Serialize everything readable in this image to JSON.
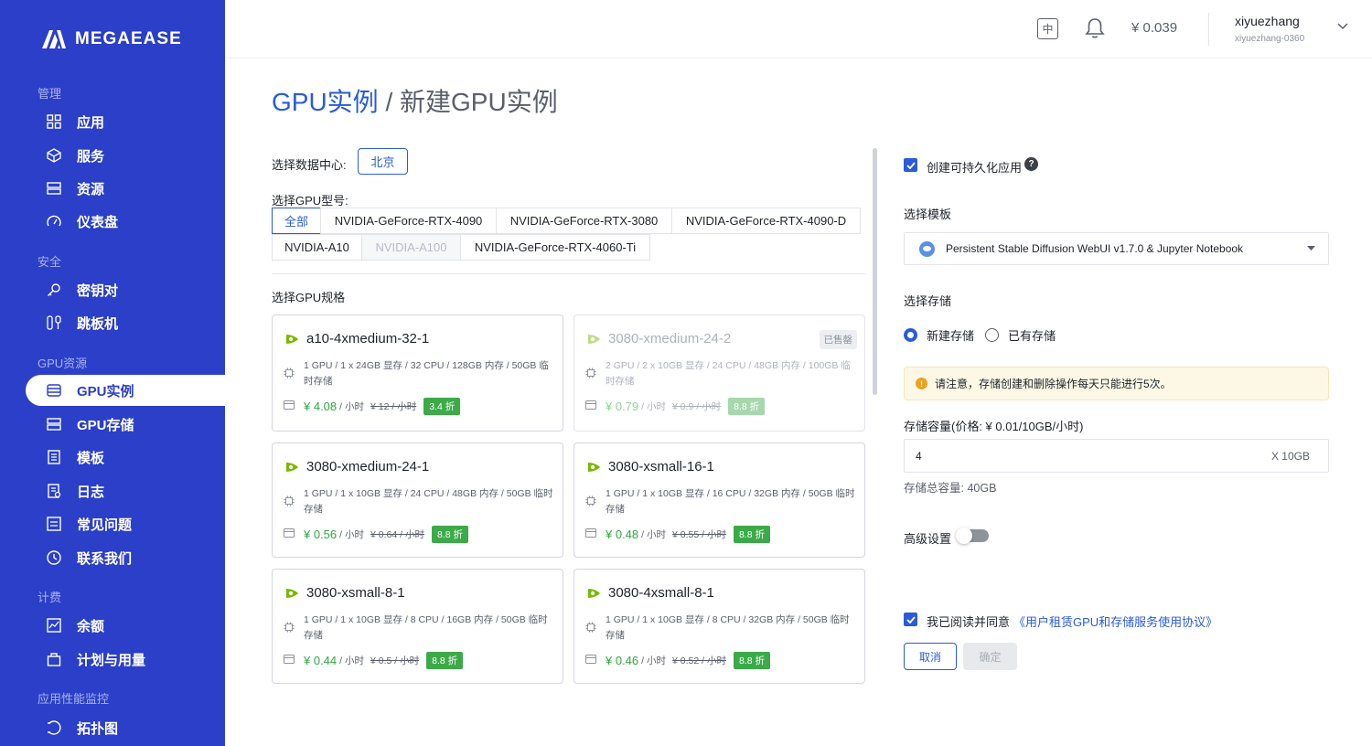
{
  "brand": {
    "name": "MEGAEASE"
  },
  "sidebar": {
    "sections": [
      {
        "title": "管理",
        "items": [
          {
            "label": "应用",
            "icon": "grid-icon"
          },
          {
            "label": "服务",
            "icon": "cube-icon"
          },
          {
            "label": "资源",
            "icon": "server-icon"
          },
          {
            "label": "仪表盘",
            "icon": "gauge-icon"
          }
        ]
      },
      {
        "title": "安全",
        "items": [
          {
            "label": "密钥对",
            "icon": "key-icon"
          },
          {
            "label": "跳板机",
            "icon": "jump-server-icon"
          }
        ]
      },
      {
        "title": "GPU资源",
        "items": [
          {
            "label": "GPU实例",
            "icon": "database-icon"
          },
          {
            "label": "GPU存储",
            "icon": "storage-icon"
          },
          {
            "label": "模板",
            "icon": "template-icon"
          },
          {
            "label": "日志",
            "icon": "log-icon"
          },
          {
            "label": "常见问题",
            "icon": "faq-icon"
          },
          {
            "label": "联系我们",
            "icon": "clock-icon"
          }
        ]
      },
      {
        "title": "计费",
        "items": [
          {
            "label": "余额",
            "icon": "chart-icon"
          },
          {
            "label": "计划与用量",
            "icon": "bag-icon"
          }
        ]
      },
      {
        "title": "应用性能监控",
        "items": [
          {
            "label": "拓扑图",
            "icon": "topology-icon"
          }
        ]
      }
    ],
    "active": "GPU实例"
  },
  "topbar": {
    "lang": "中",
    "balance": "¥ 0.039",
    "user_name": "xiyuezhang",
    "user_id": "xiyuezhang-0360"
  },
  "page": {
    "breadcrumb_link": "GPU实例",
    "breadcrumb_sep": " / ",
    "breadcrumb_current": "新建GPU实例"
  },
  "form": {
    "datacenter_label": "选择数据中心:",
    "datacenter": "北京",
    "gpu_model_label": "选择GPU型号:",
    "gpu_models_row1": [
      {
        "label": "全部",
        "state": "selected"
      },
      {
        "label": "NVIDIA-GeForce-RTX-4090",
        "state": "normal"
      },
      {
        "label": "NVIDIA-GeForce-RTX-3080",
        "state": "normal"
      },
      {
        "label": "NVIDIA-GeForce-RTX-4090-D",
        "state": "normal"
      }
    ],
    "gpu_models_row2": [
      {
        "label": "NVIDIA-A10",
        "state": "normal"
      },
      {
        "label": "NVIDIA-A100",
        "state": "disabled"
      },
      {
        "label": "NVIDIA-GeForce-RTX-4060-Ti",
        "state": "normal"
      }
    ],
    "spec_label": "选择GPU规格",
    "specs": [
      {
        "name": "a10-4xmedium-32-1",
        "spec": "1 GPU / 1 x 24GB 显存 / 32 CPU / 128GB 内存 / 50GB 临时存储",
        "price": "¥ 4.08",
        "unit": "/ 小时",
        "orig": "¥ 12 / 小时",
        "discount": "3.4 折",
        "sold_out": false
      },
      {
        "name": "3080-xmedium-24-2",
        "spec": "2 GPU / 2 x 10GB 显存 / 24 CPU / 48GB 内存 / 100GB 临时存储",
        "price": "¥ 0.79",
        "unit": "/ 小时",
        "orig": "¥ 0.9 / 小时",
        "discount": "8.8 折",
        "sold_out": true,
        "sold_label": "已售罄"
      },
      {
        "name": "3080-xmedium-24-1",
        "spec": "1 GPU / 1 x 10GB 显存 / 24 CPU / 48GB 内存 / 50GB 临时存储",
        "price": "¥ 0.56",
        "unit": "/ 小时",
        "orig": "¥ 0.64 / 小时",
        "discount": "8.8 折",
        "sold_out": false
      },
      {
        "name": "3080-xsmall-16-1",
        "spec": "1 GPU / 1 x 10GB 显存 / 16 CPU / 32GB 内存 / 50GB 临时存储",
        "price": "¥ 0.48",
        "unit": "/ 小时",
        "orig": "¥ 0.55 / 小时",
        "discount": "8.8 折",
        "sold_out": false
      },
      {
        "name": "3080-xsmall-8-1",
        "spec": "1 GPU / 1 x 10GB 显存 / 8 CPU / 16GB 内存 / 50GB 临时存储",
        "price": "¥ 0.44",
        "unit": "/ 小时",
        "orig": "¥ 0.5 / 小时",
        "discount": "8.8 折",
        "sold_out": false
      },
      {
        "name": "3080-4xsmall-8-1",
        "spec": "1 GPU / 1 x 10GB 显存 / 8 CPU / 32GB 内存 / 50GB 临时存储",
        "price": "¥ 0.46",
        "unit": "/ 小时",
        "orig": "¥ 0.52 / 小时",
        "discount": "8.8 折",
        "sold_out": false
      }
    ]
  },
  "right": {
    "persistent_label": "创建可持久化应用",
    "template_label": "选择模板",
    "template_value": "Persistent Stable Diffusion WebUI v1.7.0 & Jupyter Notebook",
    "storage_label": "选择存储",
    "storage_new": "新建存储",
    "storage_existing": "已有存储",
    "notice": "请注意，存储创建和删除操作每天只能进行5次。",
    "capacity_label": "存储容量(价格: ¥ 0.01/10GB/小时)",
    "capacity_value": "4",
    "capacity_unit": "X 10GB",
    "total_capacity": "存储总容量: 40GB",
    "advanced_label": "高级设置",
    "agree_text": "我已阅读并同意",
    "agree_link": "《用户租赁GPU和存储服务使用协议》",
    "cancel": "取消",
    "confirm": "确定"
  }
}
